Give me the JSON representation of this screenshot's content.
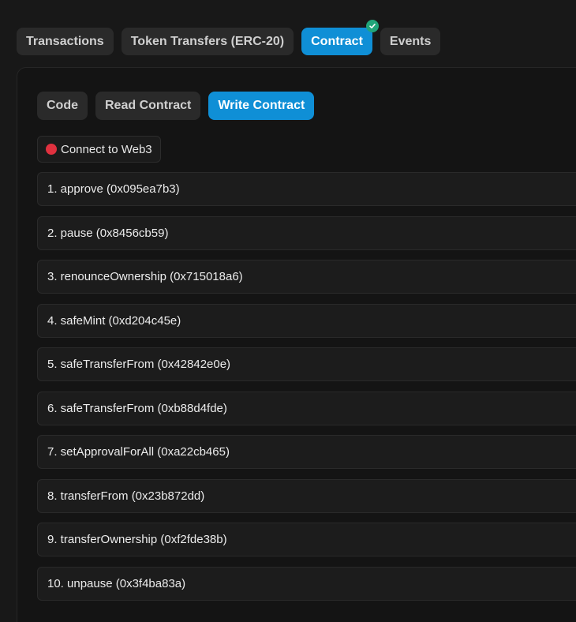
{
  "tabs": [
    {
      "label": "Transactions",
      "active": false
    },
    {
      "label": "Token Transfers (ERC-20)",
      "active": false
    },
    {
      "label": "Contract",
      "active": true
    },
    {
      "label": "Events",
      "active": false
    }
  ],
  "subtabs": [
    {
      "label": "Code",
      "active": false
    },
    {
      "label": "Read Contract",
      "active": false
    },
    {
      "label": "Write Contract",
      "active": true
    }
  ],
  "connect": {
    "label": "Connect to Web3",
    "status_icon": "red-dot-icon"
  },
  "functions": [
    "1. approve (0x095ea7b3)",
    "2. pause (0x8456cb59)",
    "3. renounceOwnership (0x715018a6)",
    "4. safeMint (0xd204c45e)",
    "5. safeTransferFrom (0x42842e0e)",
    "6. safeTransferFrom (0xb88d4fde)",
    "7. setApprovalForAll (0xa22cb465)",
    "8. transferFrom (0x23b872dd)",
    "9. transferOwnership (0xf2fde38b)",
    "10. unpause (0x3f4ba83a)"
  ],
  "colors": {
    "accent": "#0f8fd6",
    "verified": "#21a57a",
    "disconnected": "#e0313f"
  }
}
